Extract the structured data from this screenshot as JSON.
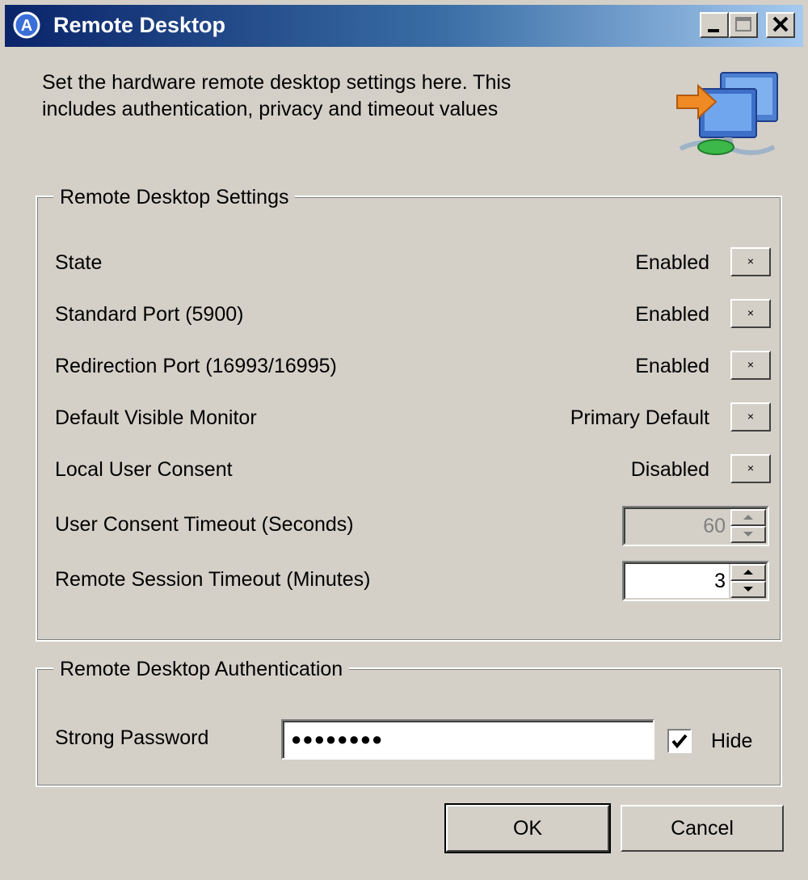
{
  "window": {
    "title": "Remote Desktop"
  },
  "intro": {
    "line1": "Set the hardware remote desktop settings here. This",
    "line2": "includes authentication, privacy and timeout values"
  },
  "settings": {
    "legend": "Remote Desktop Settings",
    "rows": [
      {
        "label": "State",
        "value": "Enabled"
      },
      {
        "label": "Standard Port (5900)",
        "value": "Enabled"
      },
      {
        "label": "Redirection Port (16993/16995)",
        "value": "Enabled"
      },
      {
        "label": "Default Visible Monitor",
        "value": "Primary Default"
      },
      {
        "label": "Local User Consent",
        "value": "Disabled"
      }
    ],
    "toggle_glyph": "×",
    "consent_timeout": {
      "label": "User Consent Timeout (Seconds)",
      "value": "60",
      "enabled": false
    },
    "session_timeout": {
      "label": "Remote Session Timeout (Minutes)",
      "value": "3",
      "enabled": true
    }
  },
  "auth": {
    "legend": "Remote Desktop Authentication",
    "password_label": "Strong Password",
    "password_value": "●●●●●●●●",
    "hide_label": "Hide",
    "hide_checked": true
  },
  "buttons": {
    "ok": "OK",
    "cancel": "Cancel"
  },
  "colors": {
    "titlebar_start": "#0a246a",
    "titlebar_end": "#a6caf0",
    "face": "#d4d0c8"
  }
}
